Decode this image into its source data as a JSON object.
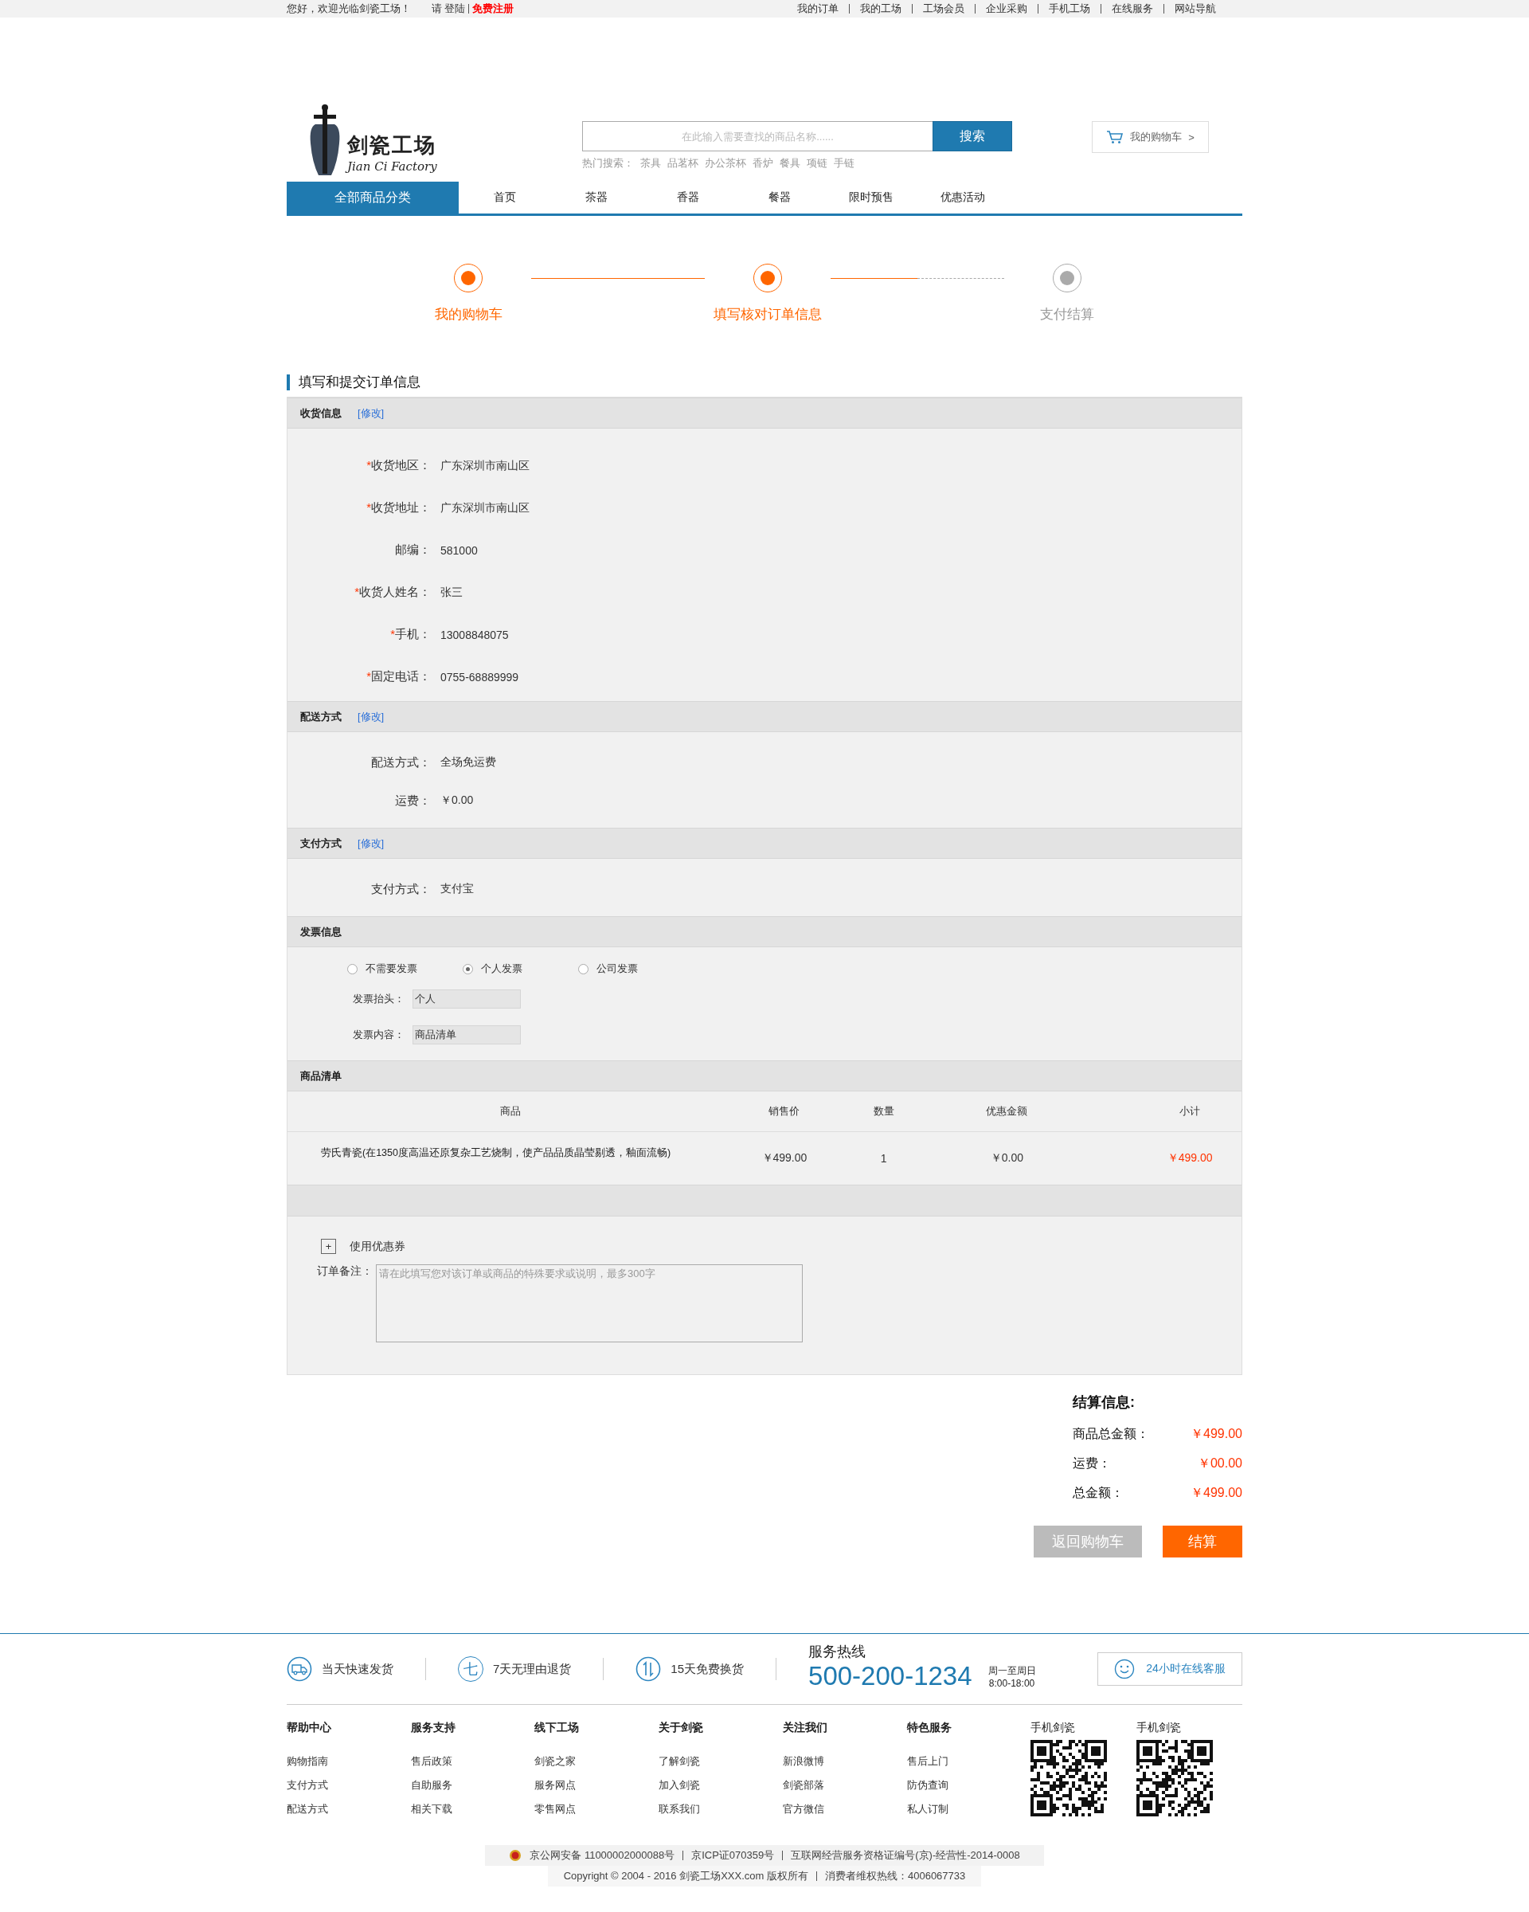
{
  "top_bar": {
    "greeting": "您好，欢迎光临剑瓷工场！",
    "login_prompt": "请",
    "login": "登陆",
    "register": "免费注册",
    "links": [
      "我的订单",
      "我的工场",
      "工场会员",
      "企业采购",
      "手机工场",
      "在线服务",
      "网站导航"
    ]
  },
  "header": {
    "logo": {
      "name": "剑瓷工场",
      "subtitle": "Jian Ci Factory"
    },
    "search": {
      "placeholder": "在此输入需要查找的商品名称......",
      "button": "搜索"
    },
    "hot_search": {
      "label": "热门搜索：",
      "terms": [
        "茶具",
        "品茗杯",
        "办公茶杯",
        "香炉",
        "餐具",
        "项链",
        "手链"
      ]
    },
    "cart": {
      "label": "我的购物车",
      "arrow": ">"
    }
  },
  "nav": {
    "all_categories": "全部商品分类",
    "items": [
      "首页",
      "茶器",
      "香器",
      "餐器",
      "限时预售",
      "优惠活动"
    ]
  },
  "steps": [
    {
      "label": "我的购物车",
      "active": true
    },
    {
      "label": "填写核对订单信息",
      "active": true
    },
    {
      "label": "支付结算",
      "active": false
    }
  ],
  "page_title": "填写和提交订单信息",
  "receiving": {
    "title": "收货信息",
    "edit": "[修改]",
    "fields": [
      {
        "mark": "*",
        "label": "收货地区：",
        "value": "广东深圳市南山区"
      },
      {
        "mark": "*",
        "label": "收货地址：",
        "value": "广东深圳市南山区"
      },
      {
        "label": "邮编：",
        "value": "581000"
      },
      {
        "mark": "*",
        "label": "收货人姓名：",
        "value": "张三"
      },
      {
        "mark": "*",
        "label": "手机：",
        "value": "13008848075"
      },
      {
        "mark": "*",
        "label": "固定电话：",
        "value": "0755-68889999"
      }
    ]
  },
  "delivery": {
    "title": "配送方式",
    "edit": "[修改]",
    "fields": [
      {
        "label": "配送方式：",
        "value": "全场免运费"
      },
      {
        "label": "运费：",
        "value": "￥0.00"
      }
    ]
  },
  "payment": {
    "title": "支付方式",
    "edit": "[修改]",
    "fields": [
      {
        "label": "支付方式：",
        "value": "支付宝"
      }
    ]
  },
  "invoice": {
    "title": "发票信息",
    "options": [
      {
        "label": "不需要发票",
        "selected": false
      },
      {
        "label": "个人发票",
        "selected": true
      },
      {
        "label": "公司发票",
        "selected": false
      }
    ],
    "fields": [
      {
        "label": "发票抬头：",
        "value": "个人"
      },
      {
        "label": "发票内容：",
        "value": "商品清单"
      }
    ]
  },
  "goods": {
    "title": "商品清单",
    "columns": [
      "商品",
      "销售价",
      "数量",
      "优惠金额",
      "小计"
    ],
    "rows": [
      {
        "product": "劳氏青瓷(在1350度高温还原复杂工艺烧制，使产品品质晶莹剔透，釉面流畅)",
        "price": "￥499.00",
        "quantity": "1",
        "discount": "￥0.00",
        "subtotal": "￥499.00"
      }
    ]
  },
  "coupon": {
    "toggle": "+",
    "label": "使用优惠券"
  },
  "remark": {
    "label": "订单备注：",
    "placeholder": "请在此填写您对该订单或商品的特殊要求或说明，最多300字"
  },
  "summary": {
    "title": "结算信息:",
    "rows": [
      {
        "label": "商品总金额：",
        "value": "￥499.00"
      },
      {
        "label": "运费：",
        "value": "￥00.00"
      },
      {
        "label": "总金额：",
        "value": "￥499.00"
      }
    ],
    "back_button": "返回购物车",
    "checkout_button": "结算"
  },
  "footer": {
    "features": [
      {
        "kind": "truck",
        "label": "当天快速发货"
      },
      {
        "kind": "glyph",
        "glyph": "七",
        "label": "7天无理由退货"
      },
      {
        "kind": "swap",
        "label": "15天免费换货"
      }
    ],
    "hotline": {
      "title": "服务热线",
      "number": "500-200-1234",
      "days": "周一至周日",
      "hours": "8:00-18:00"
    },
    "online_service": "24小时在线客服",
    "columns": [
      {
        "title": "帮助中心",
        "links": [
          "购物指南",
          "支付方式",
          "配送方式"
        ]
      },
      {
        "title": "服务支持",
        "links": [
          "售后政策",
          "自助服务",
          "相关下载"
        ]
      },
      {
        "title": "线下工场",
        "links": [
          "剑瓷之家",
          "服务网点",
          "零售网点"
        ]
      },
      {
        "title": "关于剑瓷",
        "links": [
          "了解剑瓷",
          "加入剑瓷",
          "联系我们"
        ]
      },
      {
        "title": "关注我们",
        "links": [
          "新浪微博",
          "剑瓷部落",
          "官方微信"
        ]
      },
      {
        "title": "特色服务",
        "links": [
          "售后上门",
          "防伪查询",
          "私人订制"
        ]
      }
    ],
    "qr_codes": [
      {
        "title": "手机剑瓷"
      },
      {
        "title": "手机剑瓷"
      }
    ],
    "records": [
      "京公网安备 11000002000088号",
      "京ICP证070359号",
      "互联网经营服务资格证编号(京)-经营性-2014-0008"
    ],
    "copyright": "Copyright © 2004 - 2016  剑瓷工场XXX.com 版权所有",
    "consumer_hotline": "消费者维权热线：4006067733"
  }
}
